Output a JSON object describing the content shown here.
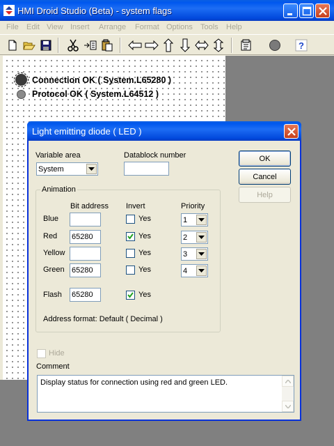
{
  "window": {
    "title": "HMI Droid Studio (Beta) - system flags"
  },
  "menu": [
    "File",
    "Edit",
    "View",
    "Insert",
    "Arrange",
    "Format",
    "Options",
    "Tools",
    "Help"
  ],
  "toolbar": {
    "icons": [
      "new-file-icon",
      "open-folder-icon",
      "save-icon",
      "cut-icon",
      "copy-icon",
      "paste-icon",
      "arrow-left-icon",
      "arrow-right-icon",
      "arrow-up-icon",
      "arrow-down-icon",
      "arrow-left-right-icon",
      "arrow-up-down-icon",
      "properties-icon",
      "record-icon",
      "help-icon"
    ]
  },
  "canvas": {
    "items": [
      {
        "label": "Connection OK ( System.L65280 )"
      },
      {
        "label": "Protocol OK ( System.L64512 )"
      }
    ]
  },
  "dialog": {
    "title": "Light emitting diode ( LED )",
    "variable_area_label": "Variable area",
    "variable_area_value": "System",
    "datablock_label": "Datablock number",
    "datablock_value": "",
    "buttons": {
      "ok": "OK",
      "cancel": "Cancel",
      "help": "Help"
    },
    "animation": {
      "title": "Animation",
      "col_bit": "Bit address",
      "col_invert": "Invert",
      "col_priority": "Priority",
      "rows": [
        {
          "name": "Blue",
          "bit": "",
          "invert_label": "Yes",
          "invert": false,
          "priority": "1"
        },
        {
          "name": "Red",
          "bit": "65280",
          "invert_label": "Yes",
          "invert": true,
          "priority": "2"
        },
        {
          "name": "Yellow",
          "bit": "",
          "invert_label": "Yes",
          "invert": false,
          "priority": "3"
        },
        {
          "name": "Green",
          "bit": "65280",
          "invert_label": "Yes",
          "invert": false,
          "priority": "4"
        }
      ],
      "flash": {
        "name": "Flash",
        "bit": "65280",
        "invert_label": "Yes",
        "invert": true
      },
      "address_format": "Address format: Default ( Decimal )"
    },
    "hide_label": "Hide",
    "comment_label": "Comment",
    "comment_text": "Display status for connection using red and green LED."
  },
  "colors": {
    "title_bar": "#0058ee",
    "close_button": "#c6401c",
    "face": "#ece9d8"
  }
}
